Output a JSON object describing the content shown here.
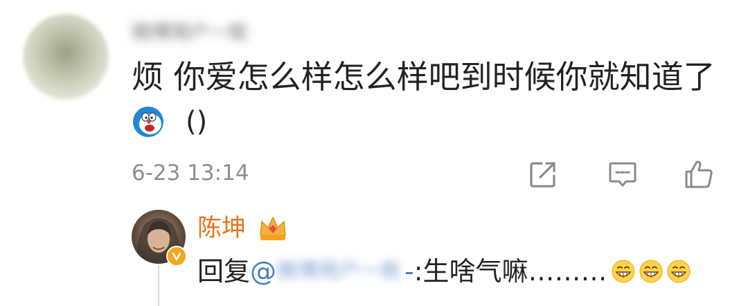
{
  "comment": {
    "username": "微博用户一枚",
    "text": "烦 你爱怎么样怎么样吧到时候你就知道了",
    "parens": "()",
    "timestamp": "6-23 13:14",
    "icons": [
      "doraemon-emoji-icon",
      "share-icon",
      "comment-icon",
      "like-icon"
    ]
  },
  "reply": {
    "author": "陈坤",
    "author_color": "#e8741a",
    "prefix": "回复",
    "mention": "@",
    "mention_name": "微博用户一枚",
    "mention_suffix": "-",
    "text": ":生啥气嘛………",
    "mention_color": "#4a7ec2",
    "icons": [
      "crown-icon",
      "verified-badge-icon",
      "grinning-emoji-icon"
    ]
  }
}
